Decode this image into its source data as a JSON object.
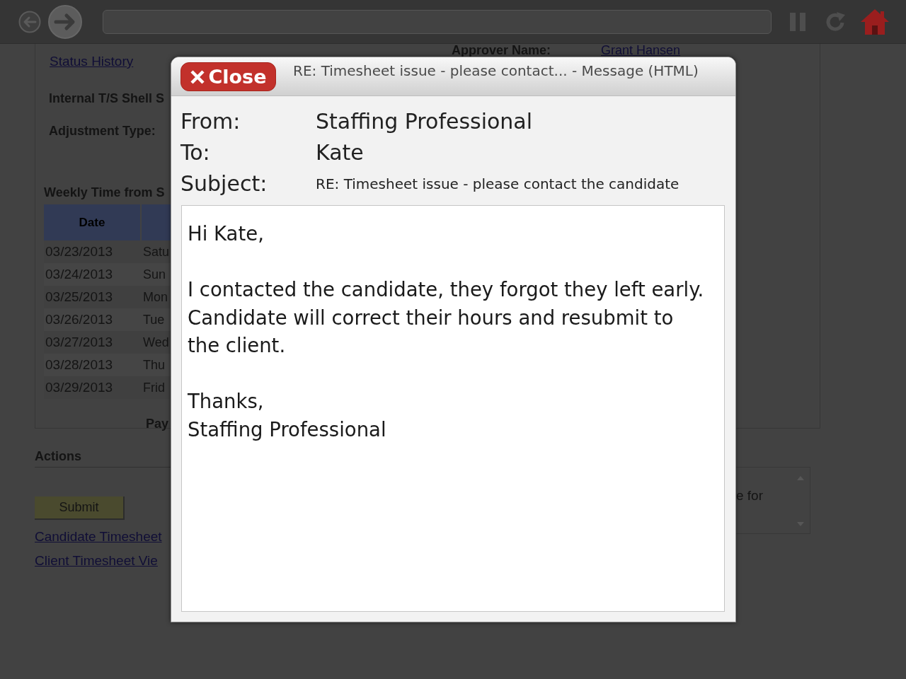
{
  "page": {
    "status_history_link": "Status History",
    "approver": {
      "label": "Approver Name:",
      "value": "Grant Hansen"
    },
    "fields": [
      {
        "label": "Internal T/S Shell S"
      },
      {
        "label": "Adjustment Type:"
      }
    ],
    "weekly_time": {
      "title": "Weekly Time from S",
      "columns": [
        "Date"
      ],
      "rows": [
        {
          "date": "03/23/2013",
          "day": "Satu"
        },
        {
          "date": "03/24/2013",
          "day": "Sun"
        },
        {
          "date": "03/25/2013",
          "day": "Mon"
        },
        {
          "date": "03/26/2013",
          "day": "Tue"
        },
        {
          "date": "03/27/2013",
          "day": "Wed"
        },
        {
          "date": "03/28/2013",
          "day": "Thu"
        },
        {
          "date": "03/29/2013",
          "day": "Frid"
        }
      ],
      "footer_label": "Pay"
    },
    "actions": {
      "title": "Actions",
      "submit_button": "Submit",
      "notes_text": "e for"
    },
    "links": [
      "Candidate Timesheet",
      "Client Timesheet Vie"
    ]
  },
  "message_dialog": {
    "close_button": "Close",
    "title": "RE: Timesheet issue - please contact... - Message (HTML)",
    "headers": [
      {
        "label": "From:",
        "value": "Staffing Professional",
        "kind": "name"
      },
      {
        "label": "To:",
        "value": "Kate",
        "kind": "name"
      },
      {
        "label": "Subject:",
        "value": "RE: Timesheet issue - please contact the candidate",
        "kind": "subject"
      }
    ],
    "body": [
      "Hi Kate,",
      "I contacted the candidate, they forgot they left early.\nCandidate will correct their hours and resubmit to\nthe client.",
      "Thanks,\nStaffing Professional"
    ]
  }
}
